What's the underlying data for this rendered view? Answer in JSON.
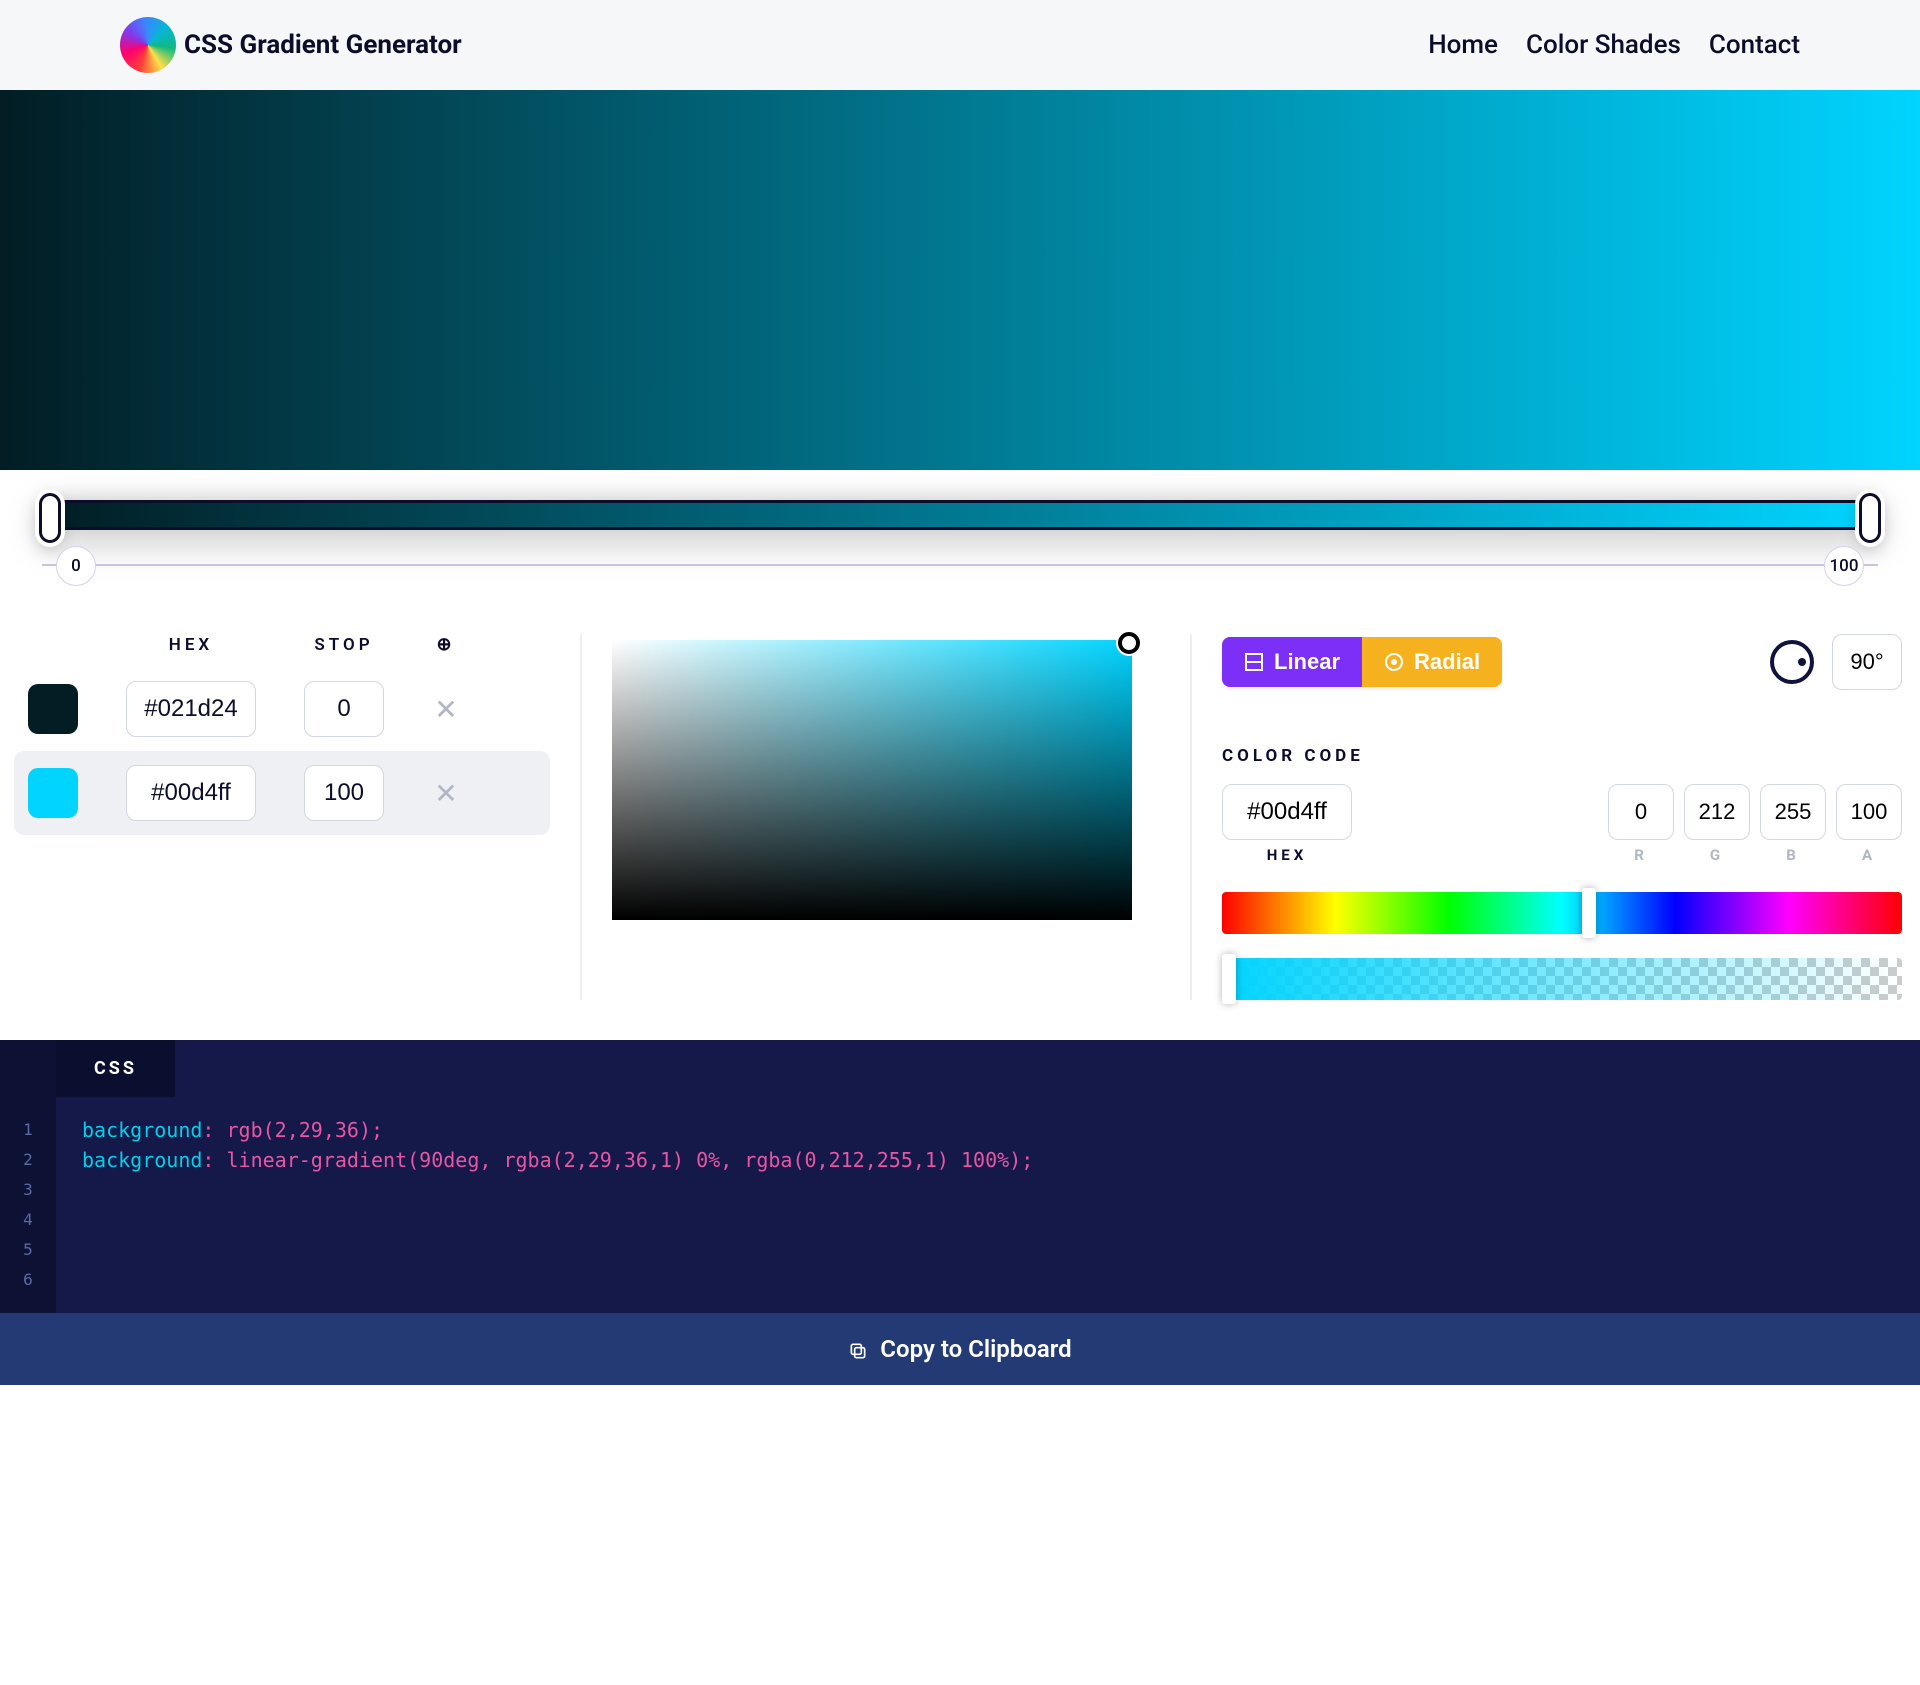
{
  "brand": {
    "title": "CSS Gradient Generator"
  },
  "nav": {
    "home": "Home",
    "shades": "Color Shades",
    "contact": "Contact"
  },
  "slider": {
    "start_label": "0",
    "end_label": "100"
  },
  "headers": {
    "hex": "HEX",
    "stop": "STOP",
    "add_symbol": "⊕"
  },
  "stops": [
    {
      "hex": "#021d24",
      "stop": "0",
      "color": "#021d24"
    },
    {
      "hex": "#00d4ff",
      "stop": "100",
      "color": "#00d4ff"
    }
  ],
  "type_toggle": {
    "linear": "Linear",
    "radial": "Radial"
  },
  "angle": "90°",
  "color_code": {
    "label": "COLOR CODE",
    "hex": "#00d4ff",
    "r": "0",
    "g": "212",
    "b": "255",
    "a": "100",
    "hex_label": "HEX",
    "r_label": "R",
    "g_label": "G",
    "b_label": "B",
    "a_label": "A"
  },
  "css_tab": "CSS",
  "css_lines": {
    "l1": "1",
    "l2": "2",
    "l3": "3",
    "l4": "4",
    "l5": "5",
    "l6": "6",
    "prop": "background",
    "val1": "rgb(2,29,36);",
    "val2": "linear-gradient(90deg, rgba(2,29,36,1) 0%, rgba(0,212,255,1) 100%);"
  },
  "copy": "Copy to Clipboard"
}
